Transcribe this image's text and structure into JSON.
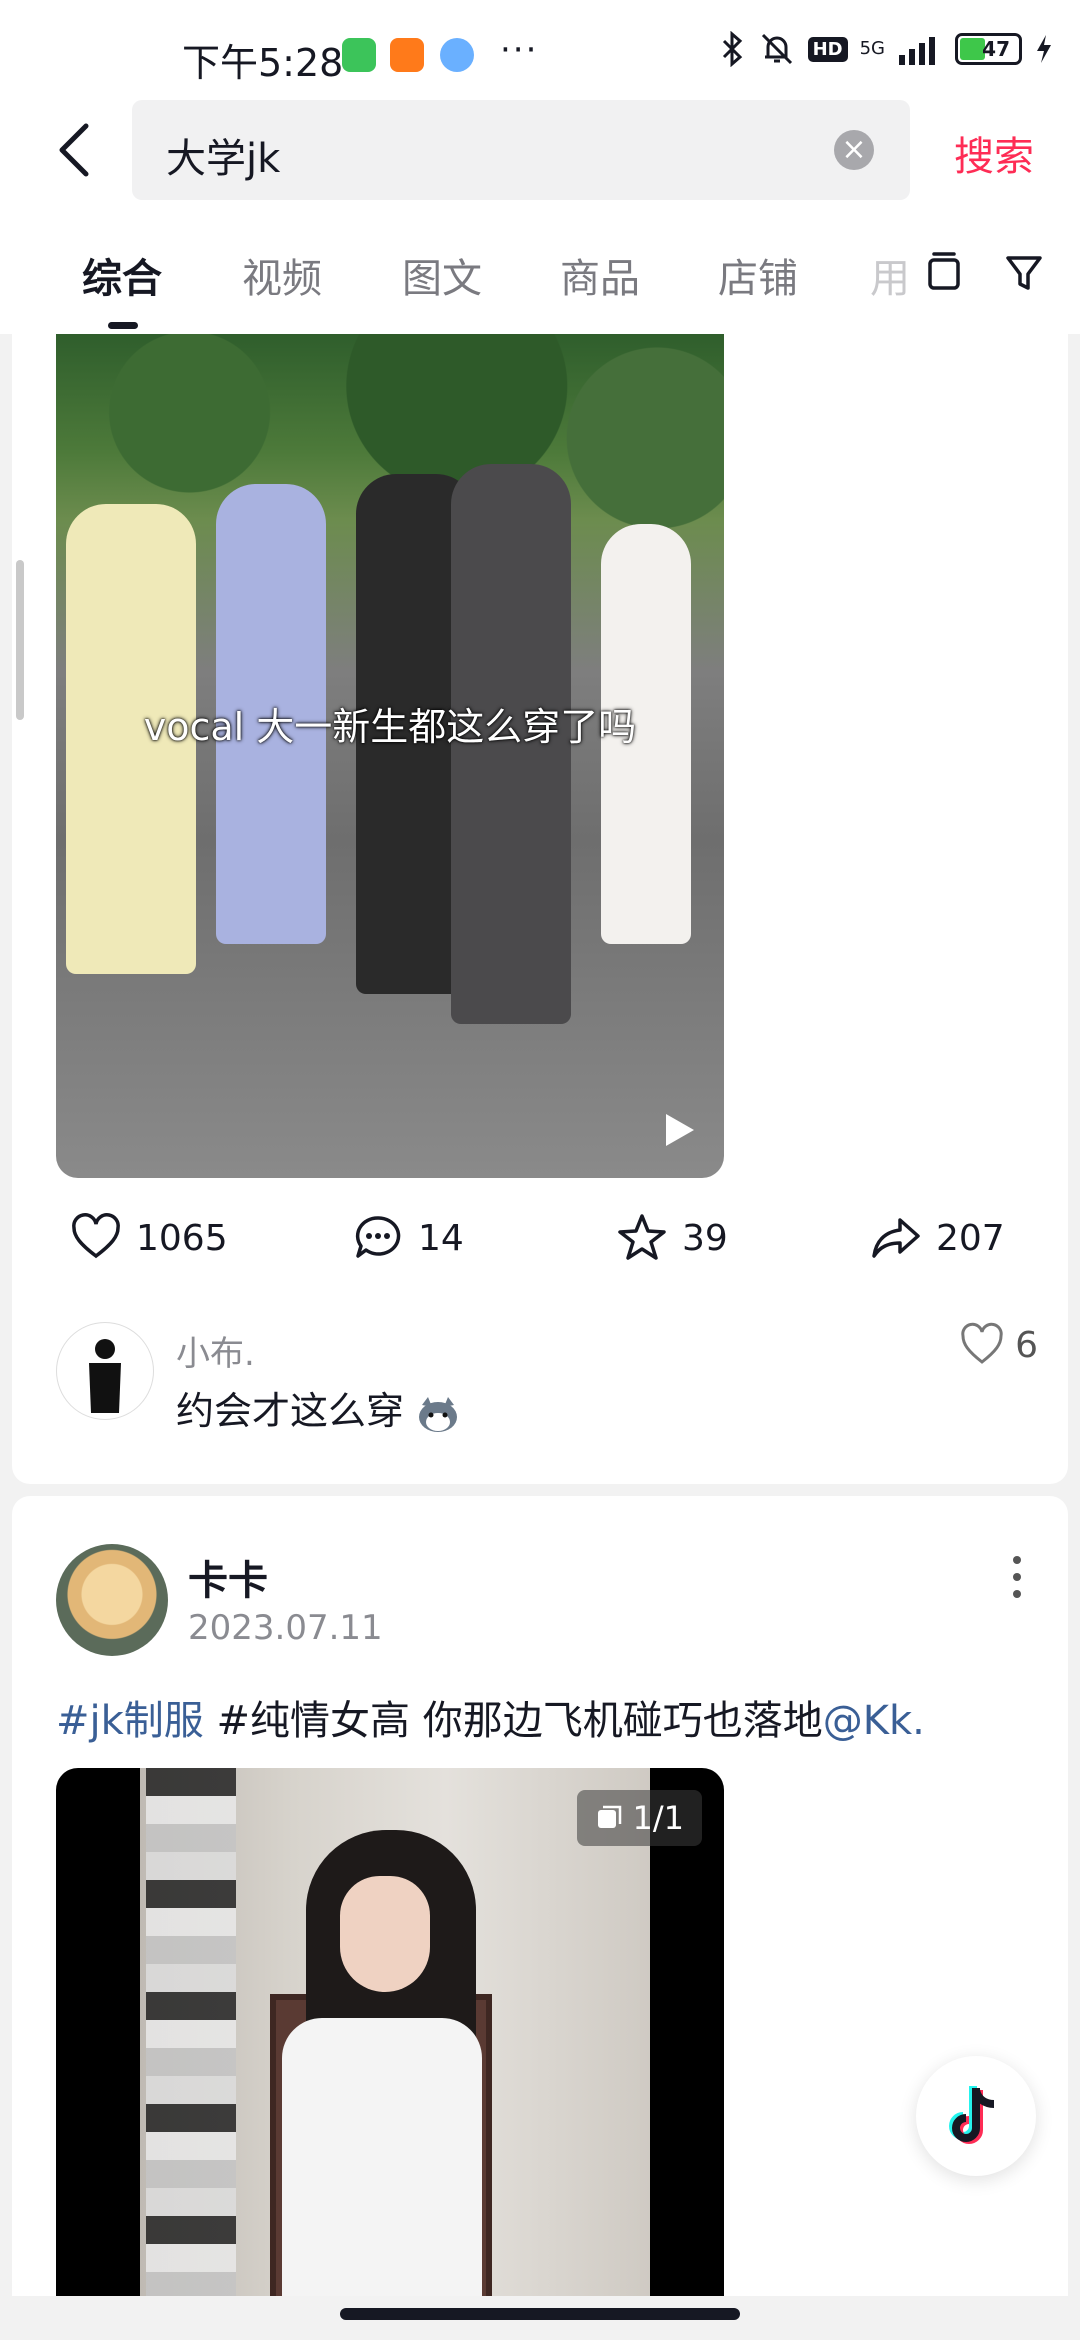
{
  "status_bar": {
    "time": "下午5:28",
    "icons": [
      "wechat-icon",
      "58-icon",
      "app-icon",
      "more-dots"
    ],
    "dots": "···",
    "hd": "HD",
    "network": "5G",
    "battery": "47",
    "battery_level": 0.47
  },
  "search": {
    "query": "大学jk",
    "clear_symbol": "×",
    "submit_label": "搜索"
  },
  "tabs": {
    "items": [
      "综合",
      "视频",
      "图文",
      "商品",
      "店铺"
    ],
    "overflow": "用",
    "active_index": 0
  },
  "video_post": {
    "caption": "vocal 大一新生都这么穿了吗",
    "likes": "1065",
    "comments": "14",
    "favorites": "39",
    "shares": "207",
    "top_comment": {
      "user": "小布.",
      "text": "约会才这么穿",
      "likes": "6"
    }
  },
  "photo_post": {
    "author": "卡卡",
    "date": "2023.07.11",
    "hashtag1": "#jk制服",
    "hashtag2": "#纯情女高",
    "body": " 你那边飞机碰巧也落地",
    "mention": "@Kk.",
    "image_count": "1/1"
  },
  "colors": {
    "accent": "#fe2c55",
    "tag": "#3a5f96",
    "text": "#161823",
    "muted": "#8a8b91"
  }
}
